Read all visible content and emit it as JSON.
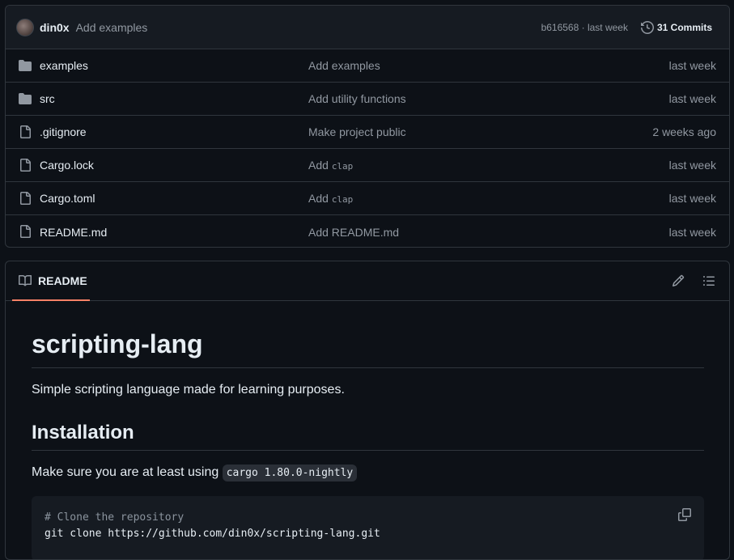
{
  "commit_header": {
    "author": "din0x",
    "message": "Add examples",
    "sha_and_time": "b616568 · last week",
    "commits_label": "31 Commits"
  },
  "files": [
    {
      "type": "folder",
      "name": "examples",
      "commit": "Add examples",
      "commit_code": "",
      "date": "last week"
    },
    {
      "type": "folder",
      "name": "src",
      "commit": "Add utility functions",
      "commit_code": "",
      "date": "last week"
    },
    {
      "type": "file",
      "name": ".gitignore",
      "commit": "Make project public",
      "commit_code": "",
      "date": "2 weeks ago"
    },
    {
      "type": "file",
      "name": "Cargo.lock",
      "commit": "Add ",
      "commit_code": "clap",
      "date": "last week"
    },
    {
      "type": "file",
      "name": "Cargo.toml",
      "commit": "Add ",
      "commit_code": "clap",
      "date": "last week"
    },
    {
      "type": "file",
      "name": "README.md",
      "commit": "Add README.md",
      "commit_code": "",
      "date": "last week"
    }
  ],
  "readme": {
    "tab_label": "README",
    "title": "scripting-lang",
    "description": "Simple scripting language made for learning purposes.",
    "installation_heading": "Installation",
    "install_text": "Make sure you are at least using ",
    "install_code": "cargo 1.80.0-nightly",
    "code_comment": "# Clone the repository",
    "code_line": "git clone https://github.com/din0x/scripting-lang.git"
  },
  "icons": {
    "folder": "folder-icon",
    "file": "file-icon",
    "history": "history-icon",
    "book": "book-icon",
    "edit": "pencil-icon",
    "outline": "list-icon",
    "copy": "copy-icon"
  },
  "colors": {
    "background": "#0d1117",
    "header_background": "#161b22",
    "border": "#30363d",
    "text": "#e6edf3",
    "muted_text": "#9198a1",
    "tab_underline": "#f78166"
  }
}
